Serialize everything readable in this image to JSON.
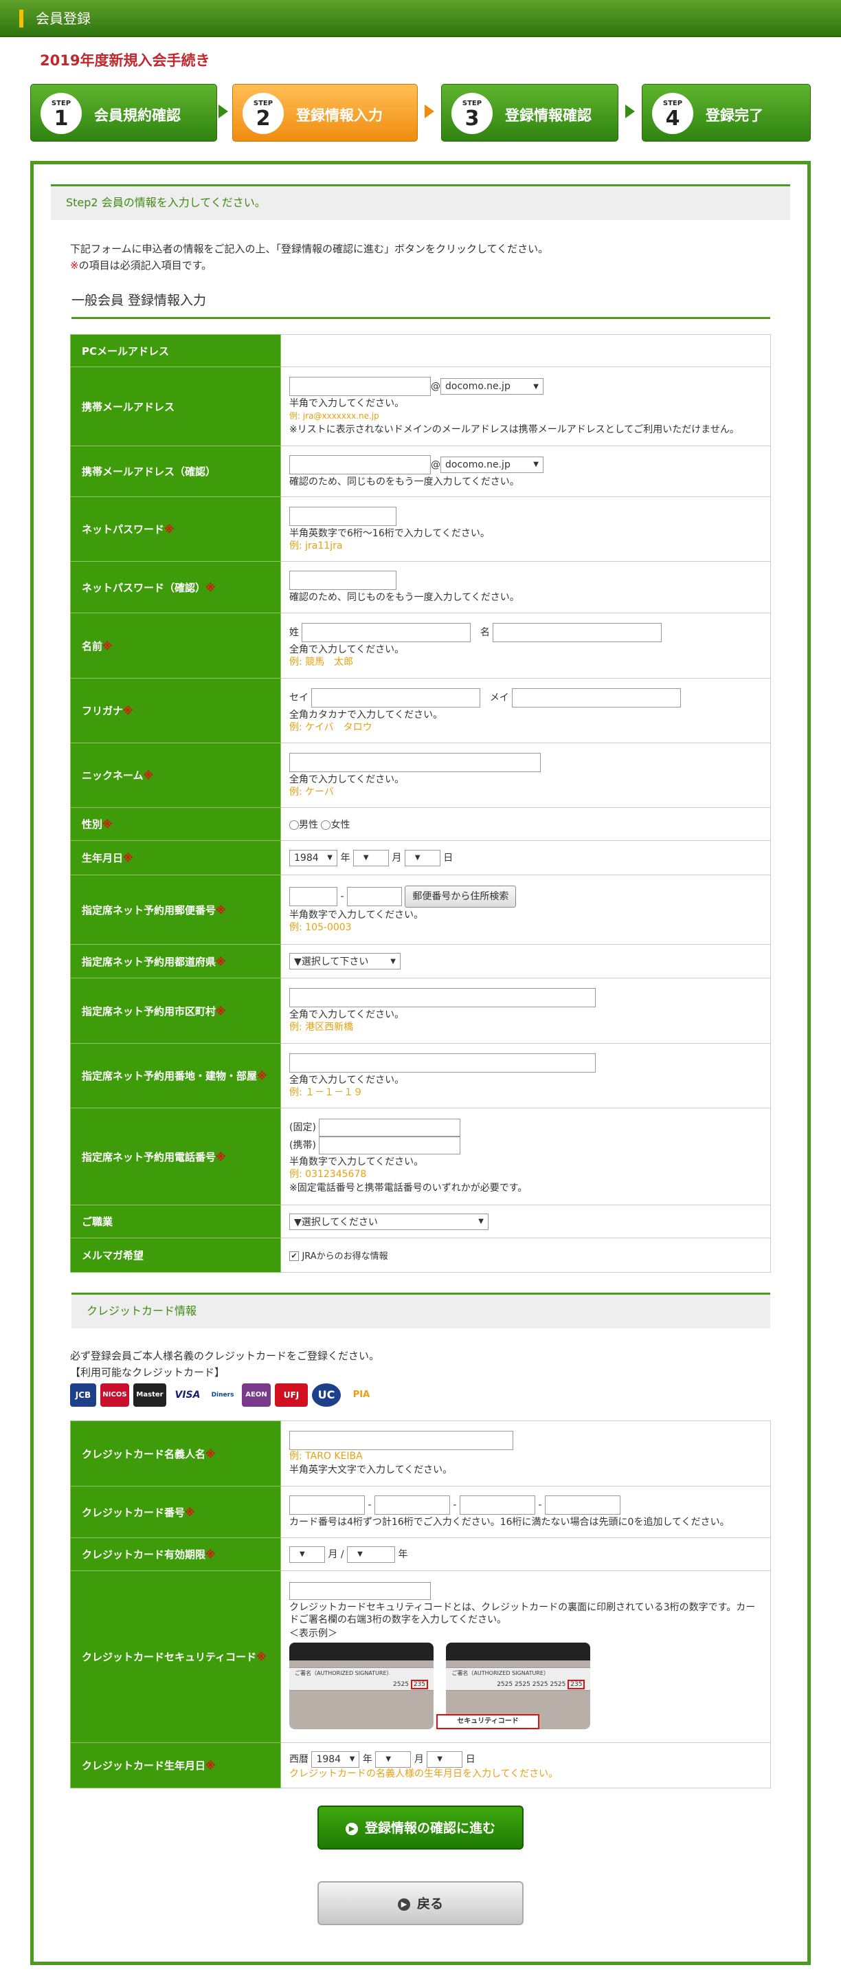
{
  "header": {
    "title": "会員登録"
  },
  "page_heading": "2019年度新規入会手続き",
  "steps": [
    {
      "step": "STEP",
      "num": "1",
      "label": "会員規約確認"
    },
    {
      "step": "STEP",
      "num": "2",
      "label": "登録情報入力"
    },
    {
      "step": "STEP",
      "num": "3",
      "label": "登録情報確認"
    },
    {
      "step": "STEP",
      "num": "4",
      "label": "登録完了"
    }
  ],
  "section1": {
    "title": "Step2 会員の情報を入力してください。"
  },
  "intro": {
    "line1": "下記フォームに申込者の情報をご記入の上、「登録情報の確認に進む」ボタンをクリックしてください。",
    "req_mark": "※",
    "line2": "の項目は必須記入項目です。"
  },
  "subheading": "一般会員 登録情報入力",
  "req": "※",
  "form": {
    "pc_mail": {
      "label": "PCメールアドレス"
    },
    "mobile_mail": {
      "label": "携帯メールアドレス",
      "at": "@",
      "domain": "docomo.ne.jp",
      "note": "半角で入力してください。",
      "example": "例: jra@xxxxxxx.ne.jp",
      "note2": "※リストに表示されないドメインのメールアドレスは携帯メールアドレスとしてご利用いただけません。"
    },
    "mobile_mail_confirm": {
      "label": "携帯メールアドレス（確認）",
      "at": "@",
      "domain": "docomo.ne.jp",
      "note": "確認のため、同じものをもう一度入力してください。"
    },
    "net_password": {
      "label": "ネットパスワード",
      "note": "半角英数字で6桁〜16桁で入力してください。",
      "example": "例: jra11jra"
    },
    "net_password_confirm": {
      "label": "ネットパスワード（確認）",
      "note": "確認のため、同じものをもう一度入力してください。"
    },
    "name": {
      "label": "名前",
      "sei": "姓",
      "mei": "名",
      "note": "全角で入力してください。",
      "example": "例: 競馬　太郎"
    },
    "furigana": {
      "label": "フリガナ",
      "sei": "セイ",
      "mei": "メイ",
      "note": "全角カタカナで入力してください。",
      "example": "例: ケイバ　タロウ"
    },
    "nickname": {
      "label": "ニックネーム",
      "note": "全角で入力してください。",
      "example": "例: ケーバ"
    },
    "gender": {
      "label": "性別",
      "male": "男性",
      "female": "女性"
    },
    "birthday": {
      "label": "生年月日",
      "year": "1984",
      "year_unit": "年",
      "month_unit": "月",
      "day_unit": "日"
    },
    "postal": {
      "label": "指定席ネット予約用郵便番号",
      "dash": "-",
      "button": "郵便番号から住所検索",
      "note": "半角数字で入力してください。",
      "example": "例: 105-0003"
    },
    "prefecture": {
      "label": "指定席ネット予約用都道府県",
      "value": "▼選択して下さい"
    },
    "city": {
      "label": "指定席ネット予約用市区町村",
      "note": "全角で入力してください。",
      "example": "例: 港区西新橋"
    },
    "address": {
      "label": "指定席ネット予約用番地・建物・部屋",
      "note": "全角で入力してください。",
      "example": "例: １－１－１９"
    },
    "phone": {
      "label": "指定席ネット予約用電話番号",
      "fixed": "(固定)",
      "mobile": "(携帯)",
      "note": "半角数字で入力してください。",
      "example": "例: 0312345678",
      "note2": "※固定電話番号と携帯電話番号のいずれかが必要です。"
    },
    "job": {
      "label": "ご職業",
      "value": "▼選択してください"
    },
    "mailmag": {
      "label": "メルマガ希望",
      "option": "JRAからのお得な情報"
    }
  },
  "section2": {
    "title": "クレジットカード情報"
  },
  "card_intro": {
    "line1": "必ず登録会員ご本人様名義のクレジットカードをご登録ください。",
    "line2": "【利用可能なクレジットカード】"
  },
  "card_brands": [
    {
      "name": "JCB",
      "color": "#1e3f8a"
    },
    {
      "name": "NICOS",
      "color": "#c8102e"
    },
    {
      "name": "Master",
      "color": "#222222"
    },
    {
      "name": "VISA",
      "color": "#ffffff"
    },
    {
      "name": "Diners",
      "color": "#ffffff"
    },
    {
      "name": "AEON",
      "color": "#7a3a8c"
    },
    {
      "name": "UFJ",
      "color": "#d01020"
    },
    {
      "name": "UC",
      "color": "#1e3f8a"
    },
    {
      "name": "PIA",
      "color": "#ffffff"
    }
  ],
  "card_form": {
    "holder": {
      "label": "クレジットカード名義人名",
      "example": "例: TARO KEIBA",
      "note": "半角英字大文字で入力してください。"
    },
    "number": {
      "label": "クレジットカード番号",
      "dash": "-",
      "note": "カード番号は4桁ずつ計16桁でご入力ください。16桁に満たない場合は先頭に0を追加してください。"
    },
    "expiry": {
      "label": "クレジットカード有効期限",
      "month_unit": "月 /",
      "year_unit": "年"
    },
    "security": {
      "label": "クレジットカードセキュリティコード",
      "note": "クレジットカードセキュリティコードとは、クレジットカードの裏面に印刷されている3桁の数字です。カードご署名欄の右端3桁の数字を入力してください。",
      "example_label": "＜表示例＞",
      "sig_text": "ご署名（AUTHORIZED SIGNATURE）",
      "num1": "2525",
      "code": "235",
      "num2": "2525 2525 2525 2525",
      "callout": "セキュリティコード"
    },
    "birthday": {
      "label": "クレジットカード生年月日",
      "era": "西暦",
      "year": "1984",
      "year_unit": "年",
      "month_unit": "月",
      "day_unit": "日",
      "note": "クレジットカードの名義人様の生年月日を入力してください。"
    }
  },
  "buttons": {
    "confirm": "登録情報の確認に進む",
    "back": "戻る"
  }
}
